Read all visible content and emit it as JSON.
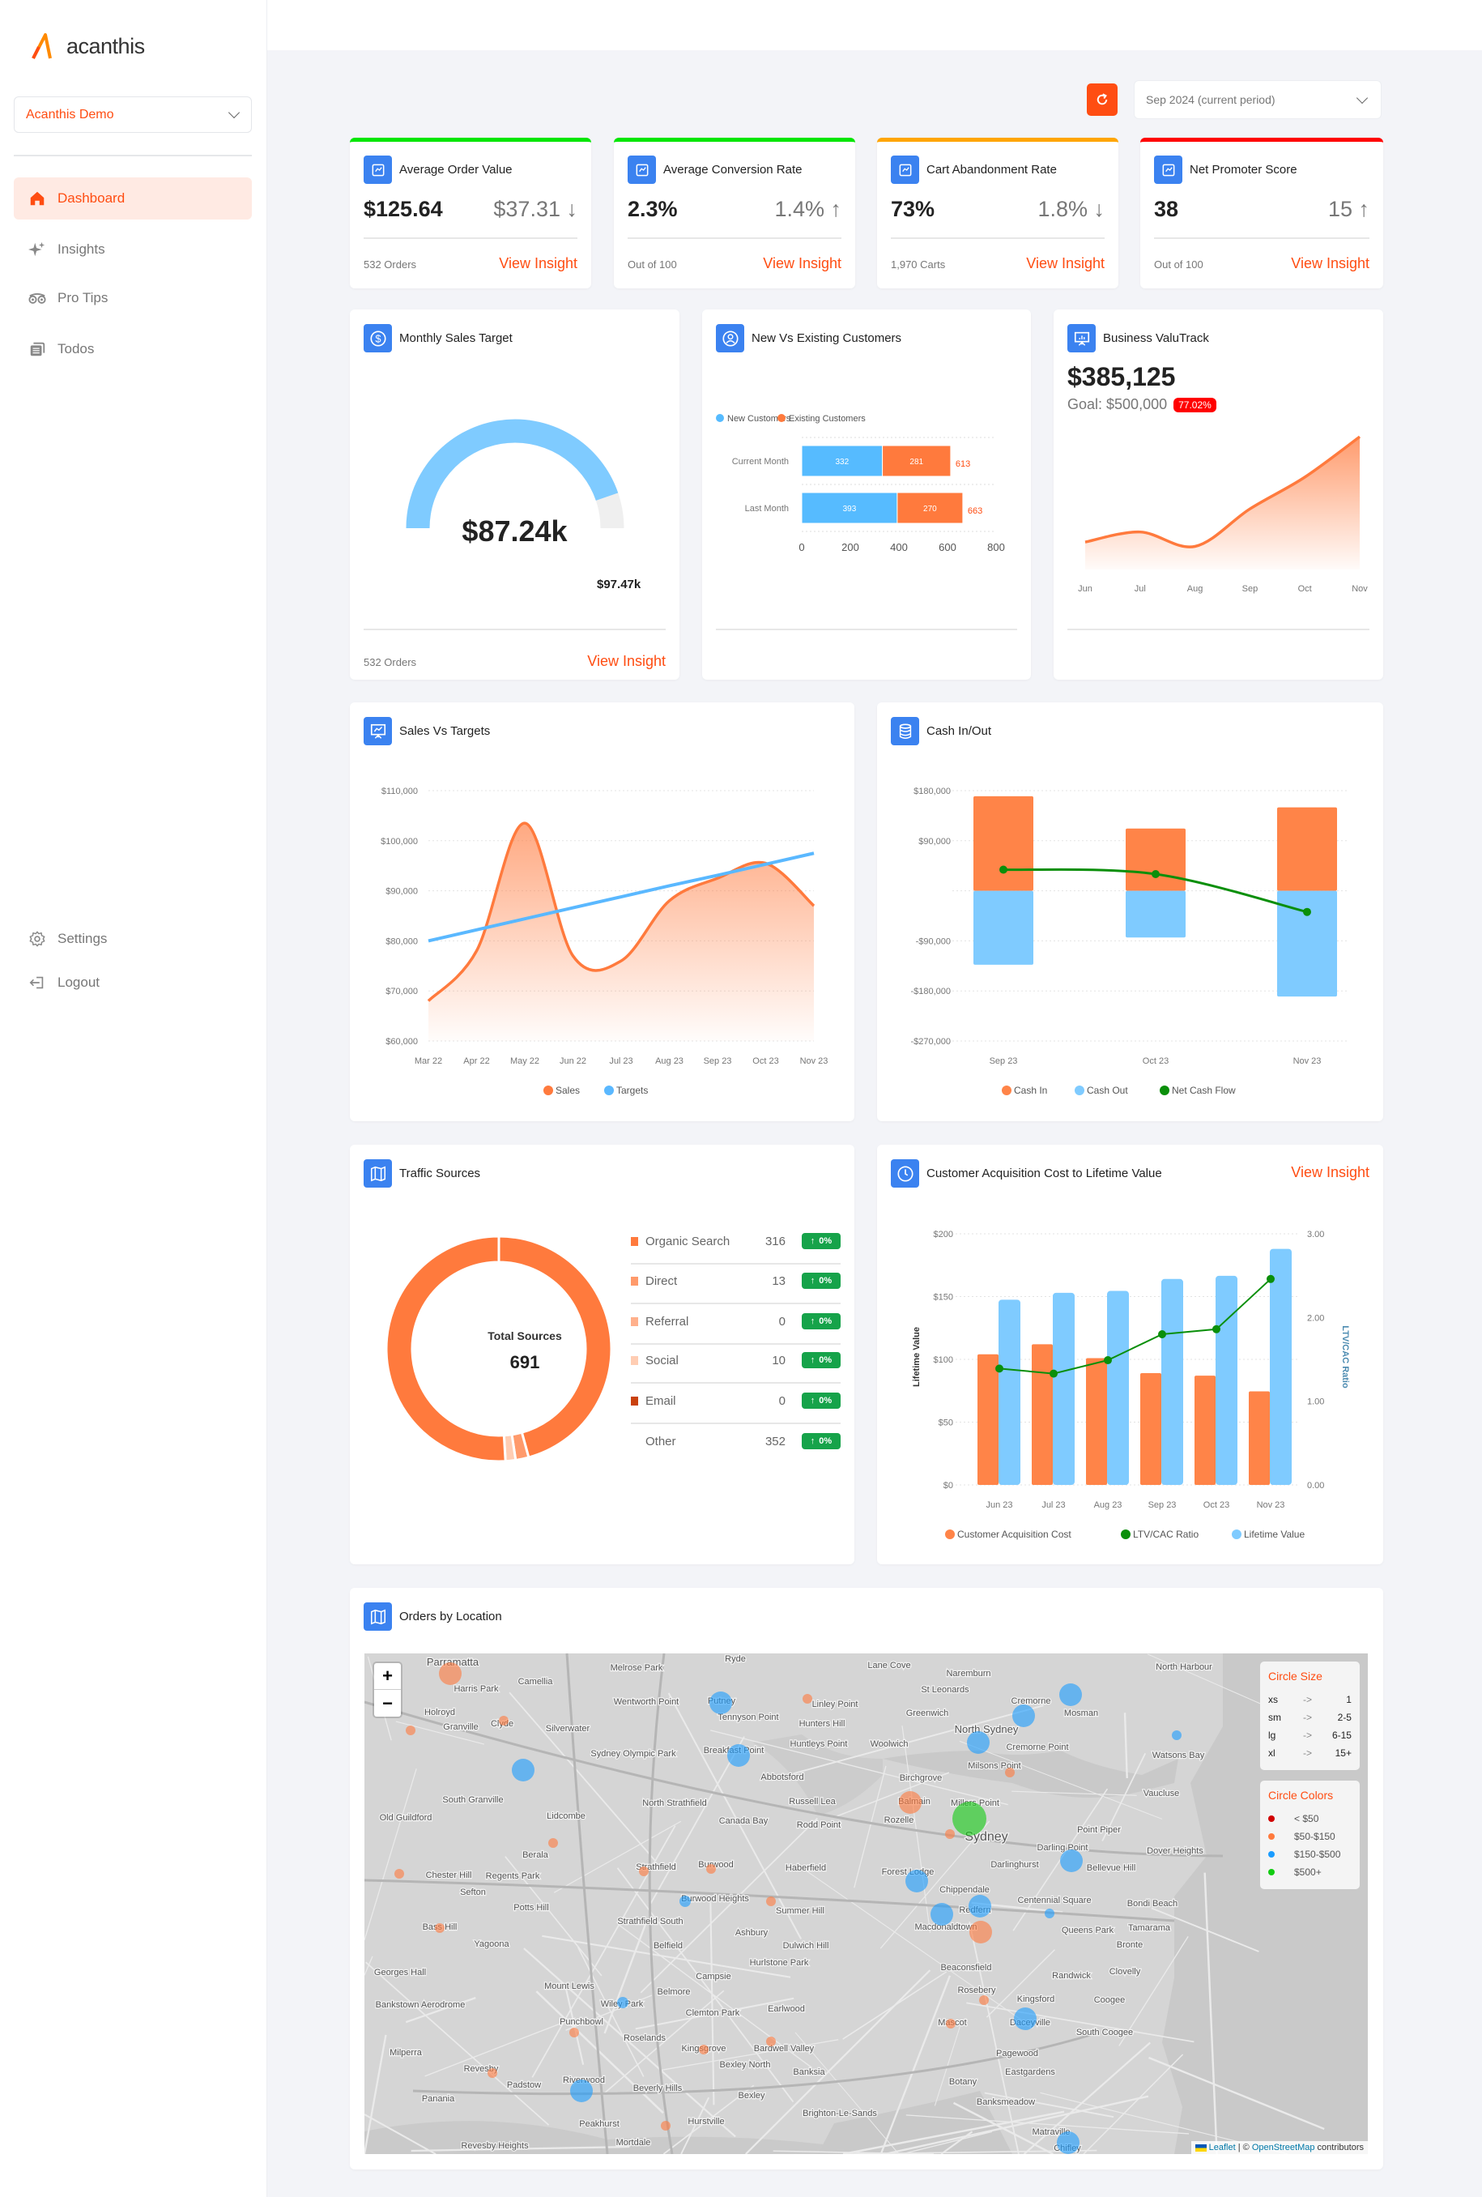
{
  "sidebar": {
    "logo": "acanthis",
    "workspace": "Acanthis Demo",
    "nav": [
      {
        "label": "Dashboard",
        "icon": "home-icon",
        "active": true
      },
      {
        "label": "Insights",
        "icon": "sparkles-icon"
      },
      {
        "label": "Pro Tips",
        "icon": "binoculars-icon"
      },
      {
        "label": "Todos",
        "icon": "todo-list-icon"
      }
    ],
    "bottom": [
      {
        "label": "Settings",
        "icon": "gear-icon"
      },
      {
        "label": "Logout",
        "icon": "logout-icon"
      }
    ]
  },
  "header": {
    "period": "Sep 2024 (current period)",
    "refresh_icon": "refresh-icon"
  },
  "colors": {
    "accent": "#ff4d12",
    "orange": "#ff7d45",
    "blue": "#7fcbff",
    "green": "#0a8f0a",
    "icon_bg": "#3b82f0"
  },
  "kpis": [
    {
      "title": "Average Order Value",
      "value": "$125.64",
      "change": "$37.31",
      "direction": "down",
      "arrow": "↓",
      "footer": "532 Orders",
      "link": "View Insight",
      "color": "#00e600",
      "icon": "wallet-icon"
    },
    {
      "title": "Average Conversion Rate",
      "value": "2.3%",
      "change": "1.4%",
      "direction": "up",
      "arrow": "↑",
      "footer": "Out of 100",
      "link": "View Insight",
      "color": "#00e600",
      "icon": "exchange-icon"
    },
    {
      "title": "Cart Abandonment Rate",
      "value": "73%",
      "change": "1.8%",
      "direction": "down",
      "arrow": "↓",
      "footer": "1,970 Carts",
      "link": "View Insight",
      "color": "#ffa500",
      "icon": "exit-icon"
    },
    {
      "title": "Net Promoter Score",
      "value": "38",
      "change": "15",
      "direction": "up",
      "arrow": "↑",
      "footer": "Out of 100",
      "link": "View Insight",
      "color": "#ff0000",
      "icon": "trend-icon"
    }
  ],
  "monthly_sales": {
    "title": "Monthly Sales Target",
    "value": "$87.24k",
    "target": "$97.47k",
    "progress": 0.895,
    "footer": "532 Orders",
    "link": "View Insight"
  },
  "new_existing": {
    "title": "New Vs Existing Customers"
  },
  "valutrack": {
    "title": "Business ValuTrack",
    "value": "$385,125",
    "goal": "Goal: $500,000",
    "badge": "77.02%"
  },
  "sales_targets": {
    "title": "Sales Vs Targets"
  },
  "cash": {
    "title": "Cash In/Out"
  },
  "traffic": {
    "title": "Traffic Sources",
    "center_label": "Total Sources",
    "total": "691",
    "rows": [
      {
        "label": "Organic Search",
        "value": "316",
        "change": "0%",
        "color": "#ff7a3d"
      },
      {
        "label": "Direct",
        "value": "13",
        "change": "0%",
        "color": "#ff9a6b"
      },
      {
        "label": "Referral",
        "value": "0",
        "change": "0%",
        "color": "#ffb08c"
      },
      {
        "label": "Social",
        "value": "10",
        "change": "0%",
        "color": "#ffcdb3"
      },
      {
        "label": "Email",
        "value": "0",
        "change": "0%",
        "color": "#c9410d"
      },
      {
        "label": "Other",
        "value": "352",
        "change": "0%",
        "color": "#ff7a3d"
      }
    ]
  },
  "cac": {
    "title": "Customer Acquisition Cost to Lifetime Value",
    "link": "View Insight"
  },
  "map": {
    "title": "Orders by Location",
    "zoom_in": "+",
    "zoom_out": "−",
    "size_legend_title": "Circle Size",
    "sizes": [
      {
        "k": "xs",
        "a": "->",
        "v": "1"
      },
      {
        "k": "sm",
        "a": "->",
        "v": "2-5"
      },
      {
        "k": "lg",
        "a": "->",
        "v": "6-15"
      },
      {
        "k": "xl",
        "a": "->",
        "v": "15+"
      }
    ],
    "color_legend_title": "Circle Colors",
    "color_bands": [
      {
        "label": "< $50",
        "color": "#d10000"
      },
      {
        "label": "$50-$150",
        "color": "#ff7a3d"
      },
      {
        "label": "$150-$500",
        "color": "#1a9cff"
      },
      {
        "label": "$500+",
        "color": "#11cc11"
      }
    ],
    "attribution_leaflet": "Leaflet",
    "attribution_sep": " | © ",
    "attribution_osm": "OpenStreetMap",
    "attribution_rest": " contributors",
    "places": [
      "Parramatta",
      "Harris Park",
      "Camellia",
      "Melrose Park",
      "Ryde",
      "Holroyd",
      "Granville",
      "Clyde",
      "Silverwater",
      "Wentworth Point",
      "Putney",
      "Tennyson Point",
      "Linley Point",
      "Hunters Hill",
      "Sydney Olympic Park",
      "Breakfast Point",
      "Huntleys Point",
      "Abbotsford",
      "South Granville",
      "North Strathfield",
      "Russell Lea",
      "Old Guildford",
      "Lidcombe",
      "Canada Bay",
      "Rodd Point",
      "Berala",
      "Strathfield",
      "Burwood",
      "Haberfield",
      "Chester Hill",
      "Regents Park",
      "Sefton",
      "Burwood Heights",
      "Summer Hill",
      "Potts Hill",
      "Strathfield South",
      "Bass Hill",
      "Ashbury",
      "Yagoona",
      "Belfield",
      "Dulwich Hill",
      "Hurlstone Park",
      "Georges Hall",
      "Campsie",
      "Mount Lewis",
      "Belmore",
      "Bankstown Aerodrome",
      "Wiley Park",
      "Clemton Park",
      "Earlwood",
      "Punchbowl",
      "Roselands",
      "Kingsgrove",
      "Bardwell Valley",
      "Milperra",
      "Bexley North",
      "Revesby",
      "Banksia",
      "Padstow",
      "Riverwood",
      "Beverly Hills",
      "Bexley",
      "Panania",
      "Peakhurst",
      "Hurstville",
      "Brighton-Le-Sands",
      "Revesby Heights",
      "Mortdale",
      "Lane Cove",
      "Naremburn",
      "North Harbour",
      "St Leonards",
      "Cremorne",
      "Greenwich",
      "Mosman",
      "North Sydney",
      "Woolwich",
      "Cremorne Point",
      "Watsons Bay",
      "Milsons Point",
      "Birchgrove",
      "Vaucluse",
      "Balmain",
      "Millers Point",
      "Rozelle",
      "Sydney",
      "Point Piper",
      "Darling Point",
      "Dover Heights",
      "Darlinghurst",
      "Bellevue Hill",
      "Forest Lodge",
      "Chippendale",
      "Centennial Square",
      "Bondi Beach",
      "Redfern",
      "Macdonaldtown",
      "Queens Park",
      "Tamarama",
      "Bronte",
      "Beaconsfield",
      "Randwick",
      "Clovelly",
      "Rosebery",
      "Kingsford",
      "Coogee",
      "Mascot",
      "Daceyville",
      "South Coogee",
      "Pagewood",
      "Eastgardens",
      "Botany",
      "Banksmeadow",
      "Matraville",
      "Chifley"
    ],
    "markers": [
      {
        "band": "$50-$150",
        "size": "lg"
      },
      {
        "band": "$50-$150",
        "size": "xs"
      },
      {
        "band": "$50-$150",
        "size": "xs"
      },
      {
        "band": "$150-$500",
        "size": "lg"
      },
      {
        "band": "$150-$500",
        "size": "lg"
      },
      {
        "band": "$50-$150",
        "size": "xs"
      },
      {
        "band": "$150-$500",
        "size": "lg"
      },
      {
        "band": "$50-$150",
        "size": "xs"
      },
      {
        "band": "$50-$150",
        "size": "xs"
      },
      {
        "band": "$50-$150",
        "size": "xs"
      },
      {
        "band": "$50-$150",
        "size": "xs"
      },
      {
        "band": "$150-$500",
        "size": "sm"
      },
      {
        "band": "$50-$150",
        "size": "xs"
      },
      {
        "band": "$50-$150",
        "size": "xs"
      },
      {
        "band": "$150-$500",
        "size": "sm"
      },
      {
        "band": "$50-$150",
        "size": "xs"
      },
      {
        "band": "$50-$150",
        "size": "xs"
      },
      {
        "band": "$50-$150",
        "size": "xs"
      },
      {
        "band": "$50-$150",
        "size": "xs"
      },
      {
        "band": "$150-$500",
        "size": "lg"
      },
      {
        "band": "$50-$150",
        "size": "xs"
      },
      {
        "band": "$150-$500",
        "size": "lg"
      },
      {
        "band": "$150-$500",
        "size": "lg"
      },
      {
        "band": "$150-$500",
        "size": "lg"
      },
      {
        "band": "$150-$500",
        "size": "xs"
      },
      {
        "band": "$50-$150",
        "size": "xs"
      },
      {
        "band": "$50-$150",
        "size": "lg"
      },
      {
        "band": "$500+",
        "size": "xl"
      },
      {
        "band": "$50-$150",
        "size": "xs"
      },
      {
        "band": "$150-$500",
        "size": "lg"
      },
      {
        "band": "$150-$500",
        "size": "lg"
      },
      {
        "band": "$150-$500",
        "size": "lg"
      },
      {
        "band": "$150-$500",
        "size": "lg"
      },
      {
        "band": "$50-$150",
        "size": "lg"
      },
      {
        "band": "$150-$500",
        "size": "xs"
      },
      {
        "band": "$50-$150",
        "size": "xs"
      },
      {
        "band": "$50-$150",
        "size": "xs"
      },
      {
        "band": "$150-$500",
        "size": "lg"
      },
      {
        "band": "$150-$500",
        "size": "lg"
      }
    ]
  },
  "chart_data": [
    {
      "id": "monthly_sales",
      "type": "gauge",
      "value": 87.24,
      "max": 97.47,
      "unit": "k$"
    },
    {
      "id": "new_existing",
      "type": "bar",
      "orientation": "horizontal",
      "stacked": true,
      "categories": [
        "Current Month",
        "Last Month"
      ],
      "series": [
        {
          "name": "New Customers",
          "values": [
            332,
            393
          ],
          "color": "#56bbff"
        },
        {
          "name": "Existing Customers",
          "values": [
            281,
            270
          ],
          "color": "#ff7a3d"
        }
      ],
      "totals": [
        "613",
        "663"
      ],
      "xlim": [
        0,
        800
      ],
      "xticks": [
        "0",
        "200",
        "400",
        "600",
        "800"
      ],
      "legend": "top-left"
    },
    {
      "id": "valutrack",
      "type": "area",
      "categories": [
        "Jun",
        "Jul",
        "Aug",
        "Sep",
        "Oct",
        "Nov"
      ],
      "values": [
        95,
        130,
        80,
        210,
        320,
        460
      ],
      "ylim": [
        0,
        480
      ],
      "color": "#ff7a3d"
    },
    {
      "id": "sales_targets",
      "type": "area",
      "categories": [
        "Mar 22",
        "Apr 22",
        "May 22",
        "Jun 22",
        "Jul 23",
        "Aug 23",
        "Sep 23",
        "Oct 23",
        "Nov 23"
      ],
      "series": [
        {
          "name": "Sales",
          "type": "area",
          "values": [
            68000,
            78000,
            103500,
            77000,
            76000,
            88000,
            92500,
            95500,
            87000
          ],
          "color": "#ff7a3d"
        },
        {
          "name": "Targets",
          "type": "line",
          "values": [
            80000,
            82200,
            84400,
            86600,
            88800,
            91000,
            93100,
            95300,
            97500
          ],
          "color": "#5ab8ff"
        }
      ],
      "ylim": [
        60000,
        110000
      ],
      "yticks": [
        "$60,000",
        "$70,000",
        "$80,000",
        "$90,000",
        "$100,000",
        "$110,000"
      ],
      "grid": true,
      "legend": "bottom"
    },
    {
      "id": "cash",
      "type": "bar",
      "categories": [
        "Sep 23",
        "Oct 23",
        "Nov 23"
      ],
      "series": [
        {
          "name": "Cash In",
          "values": [
            170000,
            112000,
            150000
          ],
          "color": "#ff8448"
        },
        {
          "name": "Cash Out",
          "values": [
            -133000,
            -84000,
            -190000
          ],
          "color": "#7fcbff"
        },
        {
          "name": "Net Cash Flow",
          "type": "line",
          "values": [
            38000,
            30000,
            -38000
          ],
          "color": "#0a8f0a"
        }
      ],
      "ylim": [
        -270000,
        180000
      ],
      "yticks": [
        180000,
        90000,
        0,
        -90000,
        -180000,
        -270000
      ],
      "ytick_labels": [
        "$180,000",
        "$90,000",
        "",
        "-$90,000",
        "-$180,000",
        "-$270,000"
      ],
      "grid": true,
      "legend": "bottom"
    },
    {
      "id": "traffic",
      "type": "pie",
      "donut": true,
      "labels": [
        "Organic Search",
        "Direct",
        "Referral",
        "Social",
        "Email",
        "Other"
      ],
      "values": [
        316,
        13,
        0,
        10,
        0,
        352
      ]
    },
    {
      "id": "cac",
      "type": "bar",
      "categories": [
        "Jun 23",
        "Jul 23",
        "Aug 23",
        "Sep 23",
        "Oct 23",
        "Nov 23"
      ],
      "series": [
        {
          "name": "Customer Acquisition Cost",
          "values": [
            104,
            112,
            101,
            89,
            87,
            74.5
          ],
          "color": "#ff8448",
          "axis": "left"
        },
        {
          "name": "LTV/CAC Ratio",
          "type": "line",
          "values": [
            1.39,
            1.33,
            1.49,
            1.8,
            1.86,
            2.46
          ],
          "color": "#0a8f0a",
          "axis": "right"
        },
        {
          "name": "Lifetime Value",
          "values": [
            147.5,
            153,
            154.5,
            164,
            166.5,
            188
          ],
          "color": "#7fcbff",
          "axis": "left"
        }
      ],
      "ylim": [
        0,
        200
      ],
      "yticks": [
        "$0",
        "$50",
        "$100",
        "$150",
        "$200"
      ],
      "ylabel": "Lifetime Value",
      "y2lim": [
        0,
        3
      ],
      "y2ticks": [
        "0.00",
        "1.00",
        "2.00",
        "3.00"
      ],
      "y2label": "LTV/CAC Ratio",
      "grid": true,
      "legend": "bottom"
    }
  ]
}
